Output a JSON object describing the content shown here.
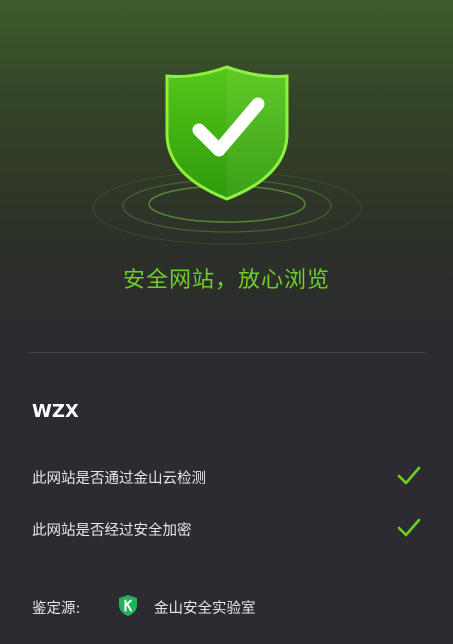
{
  "hero": {
    "icon": "shield-check-icon",
    "headline": "安全网站，放心浏览"
  },
  "site": {
    "name": "WZX"
  },
  "checks": [
    {
      "label": "此网站是否通过金山云检测",
      "icon": "check-icon",
      "passed": true
    },
    {
      "label": "此网站是否经过安全加密",
      "icon": "check-icon",
      "passed": true
    }
  ],
  "source": {
    "label": "鉴定源:",
    "icon": "kingsoft-k-icon",
    "name": "金山安全实验室"
  },
  "colors": {
    "accent_green": "#6fcf28",
    "shield_green": "#46b80e",
    "background": "#2b2b31",
    "badge_green": "#1fb45a"
  }
}
